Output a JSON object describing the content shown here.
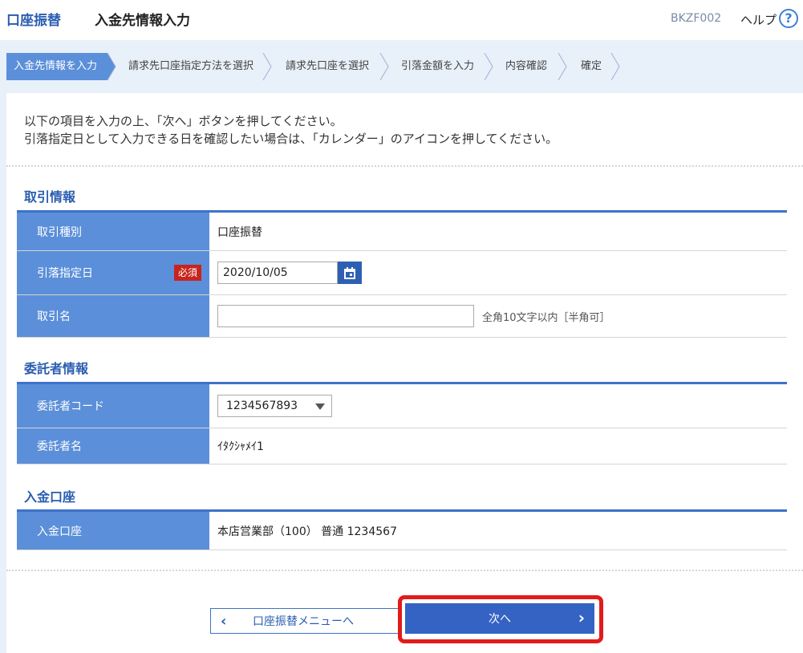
{
  "header": {
    "category": "口座振替",
    "title": "入金先情報入力",
    "screen_code": "BKZF002",
    "help_label": "ヘルプ",
    "help_icon": "?"
  },
  "steps": [
    {
      "label": "入金先情報を入力",
      "active": true
    },
    {
      "label": "請求先口座指定方法を選択",
      "active": false
    },
    {
      "label": "請求先口座を選択",
      "active": false
    },
    {
      "label": "引落金額を入力",
      "active": false
    },
    {
      "label": "内容確認",
      "active": false
    },
    {
      "label": "確定",
      "active": false
    }
  ],
  "intro": {
    "line1": "以下の項目を入力の上、「次へ」ボタンを押してください。",
    "line2": "引落指定日として入力できる日を確認したい場合は、「カレンダー」のアイコンを押してください。"
  },
  "transaction": {
    "title": "取引情報",
    "type_label": "取引種別",
    "type_value": "口座振替",
    "date_label": "引落指定日",
    "required_badge": "必須",
    "date_value": "2020/10/05",
    "name_label": "取引名",
    "name_value": "",
    "name_hint": "全角10文字以内［半角可］"
  },
  "consignor": {
    "title": "委託者情報",
    "code_label": "委託者コード",
    "code_value": "1234567893",
    "name_label": "委託者名",
    "name_value": "ｲﾀｸｼｬﾒｲ1"
  },
  "deposit": {
    "title": "入金口座",
    "account_label": "入金口座",
    "account_value": "本店営業部（100） 普通 1234567"
  },
  "buttons": {
    "back_icon": "‹",
    "back_label": "口座振替メニューへ",
    "next_label": "次へ",
    "next_icon": "›"
  },
  "colors": {
    "accent": "#3563c4",
    "header_cell": "#5b8fd9",
    "step_active": "#5b8fd9",
    "required": "#c8241c",
    "highlight": "#e21b1b"
  }
}
